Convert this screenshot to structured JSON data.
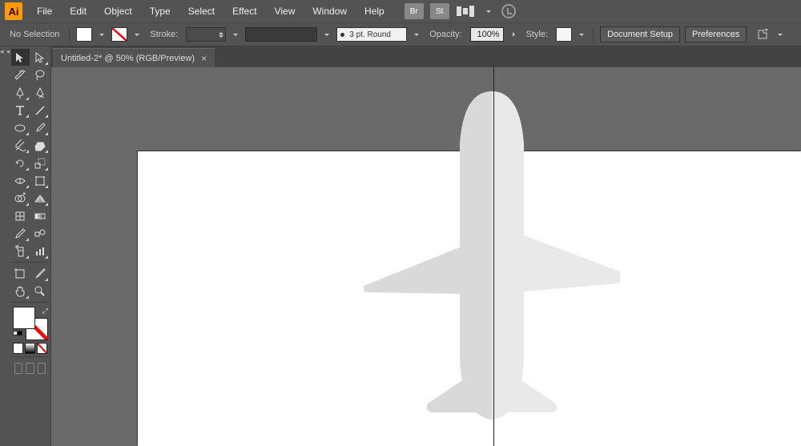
{
  "menu": {
    "file": "File",
    "edit": "Edit",
    "object": "Object",
    "type": "Type",
    "select": "Select",
    "effect": "Effect",
    "view": "View",
    "window": "Window",
    "help": "Help",
    "bridge": "Br",
    "stock": "St"
  },
  "control": {
    "selection": "No Selection",
    "stroke_label": "Stroke:",
    "profile": "3 pt. Round",
    "opacity_label": "Opacity:",
    "opacity_value": "100%",
    "style_label": "Style:",
    "doc_setup": "Document Setup",
    "preferences": "Preferences"
  },
  "tab": {
    "title": "Untitled-2* @ 50% (RGB/Preview)",
    "close": "×"
  },
  "logo": "Ai"
}
